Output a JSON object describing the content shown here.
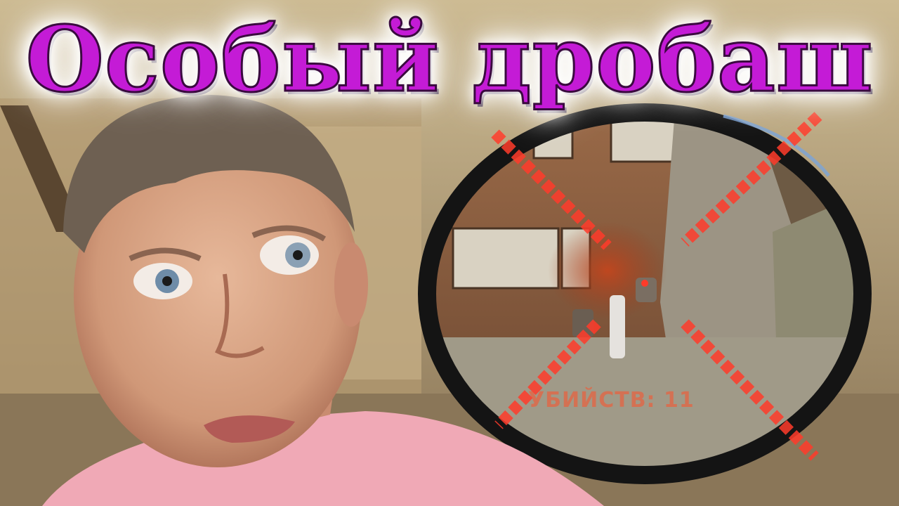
{
  "title": "Особый дробаш",
  "hud": {
    "kills_label": "УБИЙСТВ: 11",
    "crosshair": "hit-marker-icon",
    "scope": "scope-reticle-icon"
  },
  "colors": {
    "title_fill": "#c41bd6",
    "title_outline": "#3a0a3f",
    "hit_marker": "#ff3b2a"
  }
}
